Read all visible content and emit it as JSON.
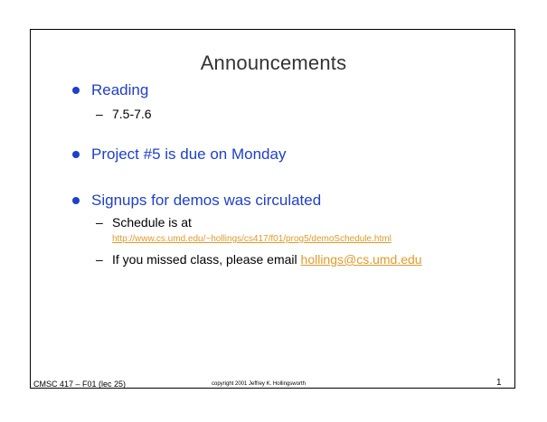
{
  "slide": {
    "title": "Announcements",
    "bullets": [
      {
        "text": "Reading",
        "subs": [
          "7.5-7.6"
        ]
      },
      {
        "text": "Project #5 is due on Monday"
      },
      {
        "text": "Signups for demos was circulated",
        "subs": [
          "Schedule is at",
          "If you missed class, please email "
        ],
        "url": "http://www.cs.umd.edu/~hollings/cs417/f01/prog5/demoSchedule.html",
        "email": "hollings@cs.umd.edu"
      }
    ],
    "dash": "–"
  },
  "footer": {
    "course": "CMSC 417 – F01  (lec 25)",
    "copyright": "copyright 2001  Jeffrey K. Hollingsworth",
    "page": "1"
  },
  "colors": {
    "bullet_blue": "#1f3fcf",
    "link_orange": "#e39a2b",
    "title_gray": "#333333"
  }
}
